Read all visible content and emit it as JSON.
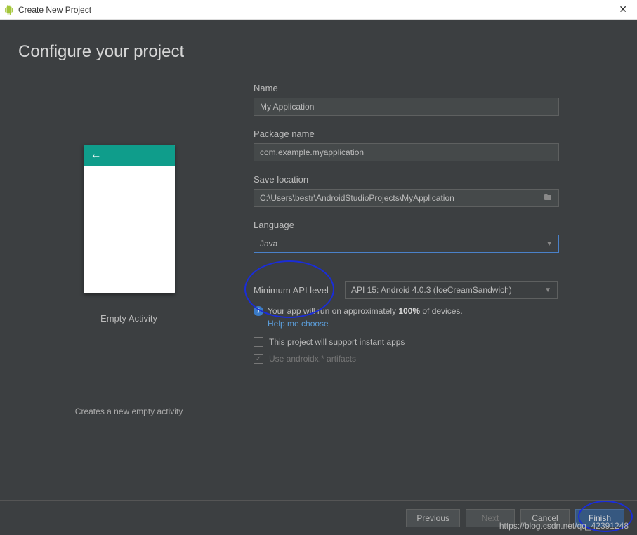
{
  "window": {
    "title": "Create New Project"
  },
  "page": {
    "heading": "Configure your project"
  },
  "preview": {
    "title": "Empty Activity",
    "description": "Creates a new empty activity",
    "back_arrow": "←"
  },
  "fields": {
    "name": {
      "label": "Name",
      "value": "My Application"
    },
    "package": {
      "label": "Package name",
      "value": "com.example.myapplication"
    },
    "save_location": {
      "label": "Save location",
      "value": "C:\\Users\\bestr\\AndroidStudioProjects\\MyApplication"
    },
    "language": {
      "label": "Language",
      "value": "Java"
    },
    "api": {
      "label": "Minimum API level",
      "value": "API 15: Android 4.0.3 (IceCreamSandwich)"
    }
  },
  "info": {
    "prefix": "Your app will run on approximately ",
    "percent": "100%",
    "suffix": " of devices.",
    "help": "Help me choose"
  },
  "checkboxes": {
    "instant_apps": {
      "label": "This project will support instant apps",
      "checked": false
    },
    "androidx": {
      "label": "Use androidx.* artifacts",
      "checked": true,
      "disabled": true
    }
  },
  "buttons": {
    "previous": "Previous",
    "next": "Next",
    "cancel": "Cancel",
    "finish": "Finish"
  },
  "watermark": "https://blog.csdn.net/qq_42391248"
}
